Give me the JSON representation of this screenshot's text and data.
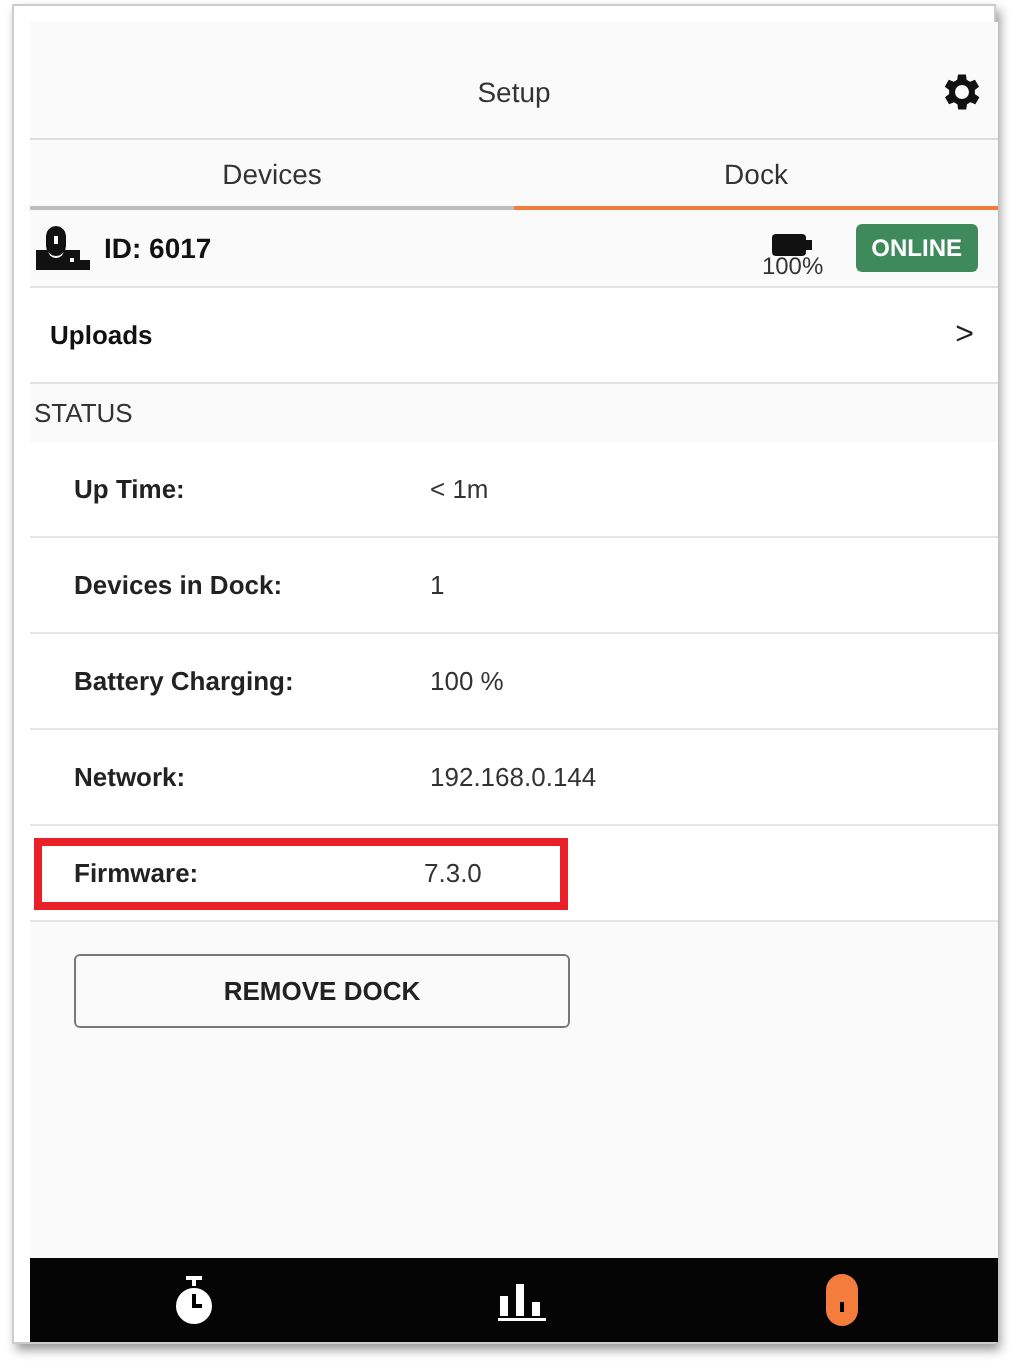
{
  "header": {
    "title": "Setup"
  },
  "tabs": [
    {
      "label": "Devices",
      "selected": false
    },
    {
      "label": "Dock",
      "selected": true
    }
  ],
  "dock": {
    "id": "ID: 6017",
    "battery": "100%",
    "status": "ONLINE",
    "online": true
  },
  "uploads": {
    "label": "Uploads",
    "chevron": ">"
  },
  "status": {
    "heading": "STATUS",
    "rows": [
      {
        "label": "Up Time:",
        "value": "< 1m",
        "highlighted": false
      },
      {
        "label": "Devices in Dock:",
        "value": "1",
        "highlighted": false
      },
      {
        "label": "Battery Charging:",
        "value": "100 %",
        "highlighted": false
      },
      {
        "label": "Network:",
        "value": "192.168.0.144",
        "highlighted": false
      },
      {
        "label": "Firmware:",
        "value": "7.3.0",
        "highlighted": true
      }
    ]
  },
  "remove_button": "REMOVE DOCK",
  "bottom_nav": [
    {
      "kind": "timer",
      "selected": false
    },
    {
      "kind": "chart",
      "selected": false
    },
    {
      "kind": "device",
      "selected": true
    }
  ]
}
